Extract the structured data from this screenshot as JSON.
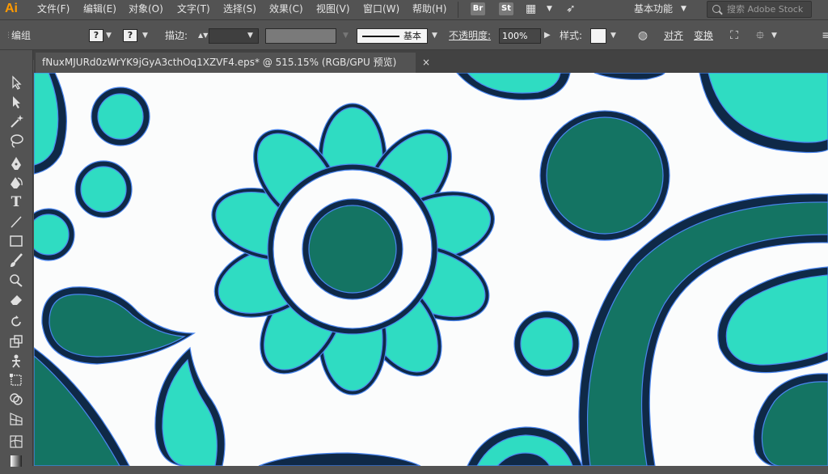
{
  "app": {
    "logo": "Ai",
    "workspace": "基本功能",
    "stock_placeholder": "搜索 Adobe Stock"
  },
  "menu": [
    "文件(F)",
    "编辑(E)",
    "对象(O)",
    "文字(T)",
    "选择(S)",
    "效果(C)",
    "视图(V)",
    "窗口(W)",
    "帮助(H)"
  ],
  "app_icons": [
    "Br",
    "St"
  ],
  "control": {
    "selection_label": "编组",
    "stroke_label": "描边:",
    "stroke_style": "基本",
    "opacity_label": "不透明度:",
    "opacity_value": "100%",
    "style_label": "样式:",
    "align_label": "对齐",
    "transform_label": "变换"
  },
  "document_tab": {
    "title": "fNuxMJURd0zWrYK9jGyA3cthOq1XZVF4.eps* @ 515.15% (RGB/GPU 预览)",
    "close": "×"
  },
  "colors": {
    "fill_light": "#2fdcc2",
    "fill_dark": "#147463",
    "outline": "#0f2947",
    "path": "#4a86f0",
    "canvas": "#fbfcfc",
    "accent": "#ff9a00"
  },
  "tools": [
    "selection-tool",
    "direct-selection-tool",
    "magic-wand-tool",
    "lasso-tool",
    "pen-tool",
    "curvature-tool",
    "type-tool",
    "line-segment-tool",
    "rectangle-tool",
    "paintbrush-tool",
    "shaper-tool",
    "eraser-tool",
    "rotate-tool",
    "scale-tool",
    "puppet-warp-tool",
    "free-transform-tool",
    "shape-builder-tool",
    "perspective-grid-tool",
    "mesh-tool",
    "gradient-tool"
  ]
}
